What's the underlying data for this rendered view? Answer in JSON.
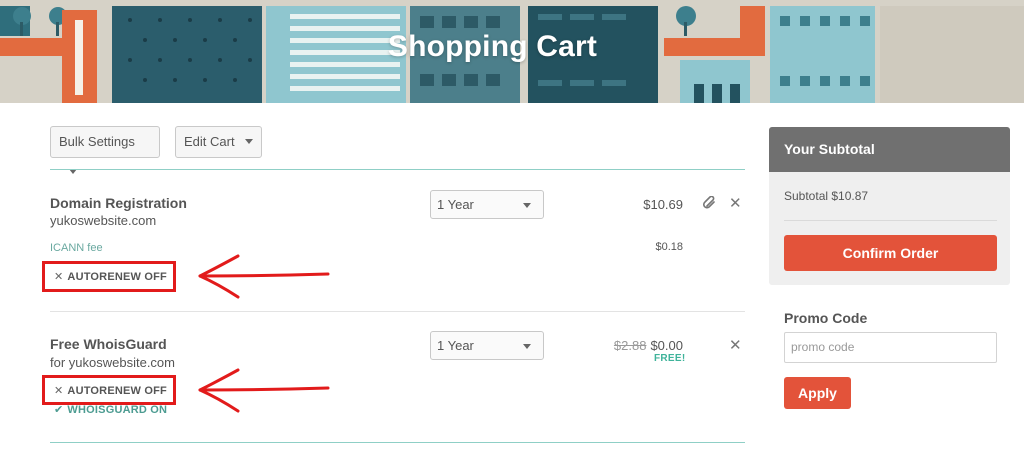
{
  "banner": {
    "title": "Shopping Cart"
  },
  "toolbar": {
    "bulk_settings": "Bulk Settings",
    "edit_cart": "Edit Cart"
  },
  "items": [
    {
      "title": "Domain Registration",
      "subtitle": "yukoswebsite.com",
      "term": "1 Year",
      "price": "$10.69",
      "fee_label": "ICANN fee",
      "fee_price": "$0.18",
      "autorenew": "AUTORENEW OFF"
    },
    {
      "title": "Free WhoisGuard",
      "subtitle": "for yukoswebsite.com",
      "term": "1 Year",
      "old_price": "$2.88",
      "price": "$0.00",
      "free_label": "FREE!",
      "autorenew": "AUTORENEW OFF",
      "whoisguard": "WHOISGUARD ON"
    }
  ],
  "subtotal": {
    "heading": "Your Subtotal",
    "text": "Subtotal $10.87",
    "confirm": "Confirm Order"
  },
  "promo": {
    "label": "Promo Code",
    "placeholder": "promo code",
    "apply": "Apply"
  },
  "colors": {
    "accent": "#e3533a",
    "teal": "#8fcfc6",
    "annotation_red": "#e21b1b"
  }
}
